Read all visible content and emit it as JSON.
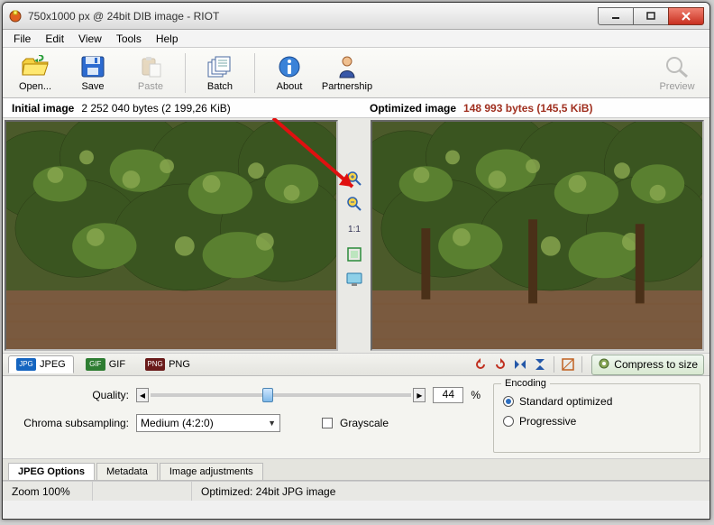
{
  "title": "750x1000 px @ 24bit  DIB image - RIOT",
  "menu": [
    "File",
    "Edit",
    "View",
    "Tools",
    "Help"
  ],
  "toolbar": {
    "open": "Open...",
    "save": "Save",
    "paste": "Paste",
    "batch": "Batch",
    "about": "About",
    "partnership": "Partnership",
    "preview": "Preview"
  },
  "info": {
    "initial_label": "Initial image",
    "initial_bytes": "2 252 040 bytes (2 199,26 KiB)",
    "optimized_label": "Optimized image",
    "optimized_bytes": "148 993 bytes (145,5 KiB)"
  },
  "mid_toolbar": {
    "one_to_one": "1:1"
  },
  "format_tabs": {
    "jpeg": "JPEG",
    "gif": "GIF",
    "png": "PNG"
  },
  "small_tools_alt": [
    "undo",
    "redo",
    "fliph",
    "flipv",
    "sep",
    "rotate",
    "sep",
    "settings"
  ],
  "compress_label": "Compress to size",
  "options": {
    "quality_label": "Quality:",
    "quality_value": "44",
    "quality_pct": "%",
    "chroma_label": "Chroma subsampling:",
    "chroma_value": "Medium (4:2:0)",
    "grayscale_label": "Grayscale",
    "encoding_legend": "Encoding",
    "radio_standard": "Standard optimized",
    "radio_progressive": "Progressive"
  },
  "bottom_tabs": [
    "JPEG Options",
    "Metadata",
    "Image adjustments"
  ],
  "status": {
    "zoom": "Zoom 100%",
    "optimized": "Optimized: 24bit JPG image"
  }
}
